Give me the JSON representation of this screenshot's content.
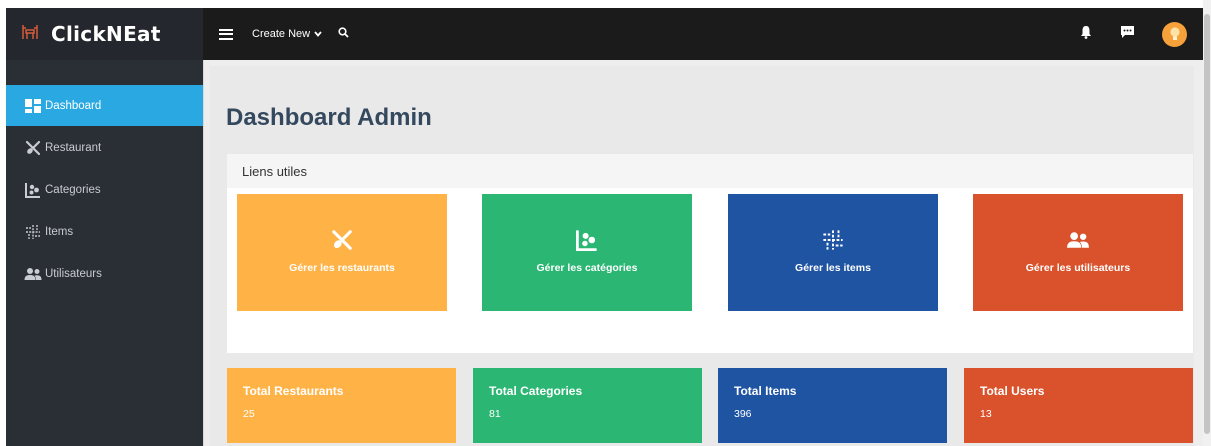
{
  "brand": {
    "name": "ClickNEat"
  },
  "topbar": {
    "create_new": "Create New"
  },
  "colors": {
    "orange": "#ffb347",
    "green": "#2bb673",
    "blue": "#1f54a3",
    "red": "#d9522c",
    "sidebar_active": "#2aa8e2"
  },
  "sidebar": {
    "items": [
      {
        "label": "Dashboard",
        "icon": "dashboard-icon",
        "active": true
      },
      {
        "label": "Restaurant",
        "icon": "utensils-icon"
      },
      {
        "label": "Categories",
        "icon": "categories-icon"
      },
      {
        "label": "Items",
        "icon": "grid-icon"
      },
      {
        "label": "Utilisateurs",
        "icon": "users-icon"
      }
    ]
  },
  "main": {
    "title": "Dashboard Admin",
    "liens_title": "Liens utiles",
    "cards": [
      {
        "label": "Gérer les restaurants",
        "icon": "utensils-icon"
      },
      {
        "label": "Gérer les catégories",
        "icon": "categories-icon"
      },
      {
        "label": "Gérer les items",
        "icon": "grid-icon"
      },
      {
        "label": "Gérer les utilisateurs",
        "icon": "users-icon"
      }
    ],
    "stats": [
      {
        "title": "Total Restaurants",
        "value": "25"
      },
      {
        "title": "Total Categories",
        "value": "81"
      },
      {
        "title": "Total Items",
        "value": "396"
      },
      {
        "title": "Total Users",
        "value": "13"
      }
    ]
  }
}
